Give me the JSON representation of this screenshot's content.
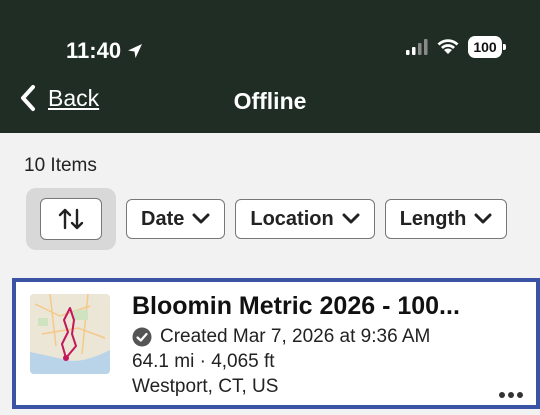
{
  "status_bar": {
    "time": "11:40",
    "battery": "100"
  },
  "nav": {
    "back_label": "Back",
    "title": "Offline"
  },
  "list": {
    "count_label": "10 Items"
  },
  "filters": {
    "date": "Date",
    "location": "Location",
    "length": "Length"
  },
  "route": {
    "title": "Bloomin Metric 2026 - 100...",
    "created": "Created Mar 7, 2026 at 9:36 AM",
    "stats": "64.1 mi · 4,065 ft",
    "location": "Westport, CT, US"
  },
  "icons": {
    "location_arrow": "location-arrow-icon",
    "signal": "signal-icon",
    "wifi": "wifi-icon",
    "back": "chevron-left-icon",
    "sort": "sort-arrows-icon",
    "dropdown": "chevron-down-icon",
    "created": "check-circle-icon",
    "more": "more-icon"
  },
  "colors": {
    "header": "#1f2d24",
    "selection_border": "#3a53a4",
    "route_line": "#c2185b"
  }
}
